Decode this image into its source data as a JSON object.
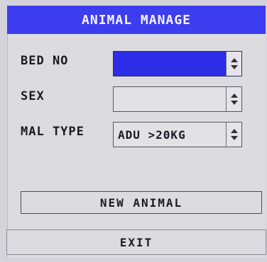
{
  "title": "ANIMAL MANAGE",
  "form": {
    "bed_no": {
      "label": "BED NO",
      "value": ""
    },
    "sex": {
      "label": "SEX",
      "value": ""
    },
    "mal_type": {
      "label": "MAL TYPE",
      "value": "ADU >20KG"
    }
  },
  "buttons": {
    "new_animal": "NEW ANIMAL",
    "exit": "EXIT"
  },
  "colors": {
    "title_bar": "#3d3df0",
    "selected_field": "#2d2de8",
    "panel": "#dcdce0"
  },
  "icons": {
    "spinner": "up-down-arrows-icon"
  }
}
